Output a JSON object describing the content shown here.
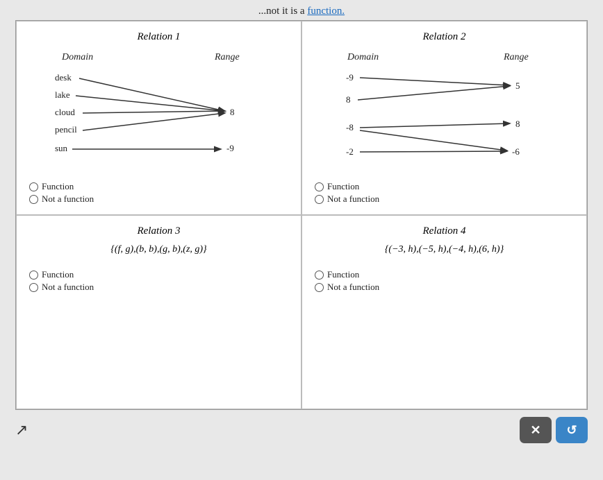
{
  "header": {
    "text": "...not it is a ",
    "link": "function."
  },
  "relation1": {
    "title": "Relation 1",
    "domain_label": "Domain",
    "range_label": "Range",
    "domain_items": [
      "desk",
      "lake",
      "cloud",
      "pencil",
      "sun"
    ],
    "range_items": [
      "8",
      "-9"
    ],
    "option_function": "Function",
    "option_not_function": "Not a function"
  },
  "relation2": {
    "title": "Relation 2",
    "domain_label": "Domain",
    "range_label": "Range",
    "domain_items": [
      "-9",
      "8",
      "-8",
      "-2"
    ],
    "range_items": [
      "5",
      "8",
      "-6"
    ],
    "option_function": "Function",
    "option_not_function": "Not a function"
  },
  "relation3": {
    "title": "Relation 3",
    "set": "{(f, g),(b, b),(g, b),(z, g)}",
    "option_function": "Function",
    "option_not_function": "Not a function"
  },
  "relation4": {
    "title": "Relation 4",
    "set": "{(−3, h),(−5, h),(−4, h),(6, h)}",
    "option_function": "Function",
    "option_not_function": "Not a function"
  },
  "buttons": {
    "x_label": "✕",
    "redo_label": "↺"
  }
}
